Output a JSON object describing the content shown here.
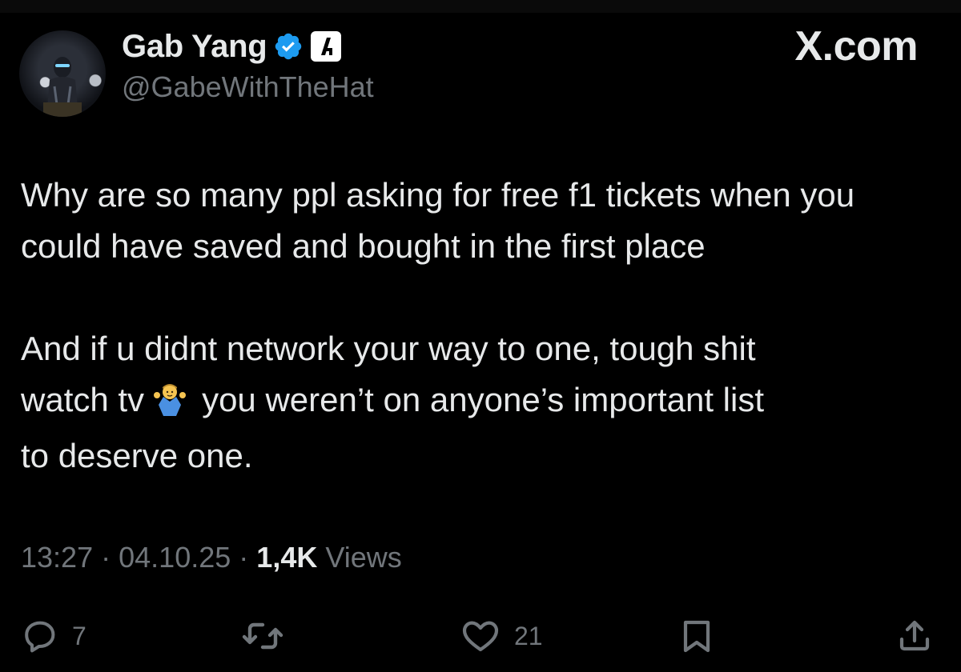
{
  "header": {
    "display_name": "Gab Yang",
    "handle": "@GabeWithTheHat",
    "brand": "X.com",
    "verified_icon": "verified-badge-icon",
    "affiliate_icon": "affiliate-logo-icon"
  },
  "tweet": {
    "paragraph1": "Why are so many ppl asking for free f1 tickets when you could have saved and bought in the first place",
    "paragraph2_line1": "And if u didnt network your way to one, tough shit",
    "paragraph2_line2a": "watch tv",
    "emoji": "man-shrugging-emoji",
    "paragraph2_line2b": "you weren’t on anyone’s important list",
    "paragraph2_line3": "to deserve one."
  },
  "meta": {
    "time": "13:27",
    "date": "04.10.25",
    "separator": "·",
    "views_count": "1,4K",
    "views_label": "Views"
  },
  "actions": {
    "reply_count": "7",
    "repost_count": "",
    "like_count": "21"
  },
  "colors": {
    "background": "#000000",
    "primary_text": "#e7e9ea",
    "secondary_text": "#71767b",
    "verified_blue": "#1d9bf0"
  }
}
